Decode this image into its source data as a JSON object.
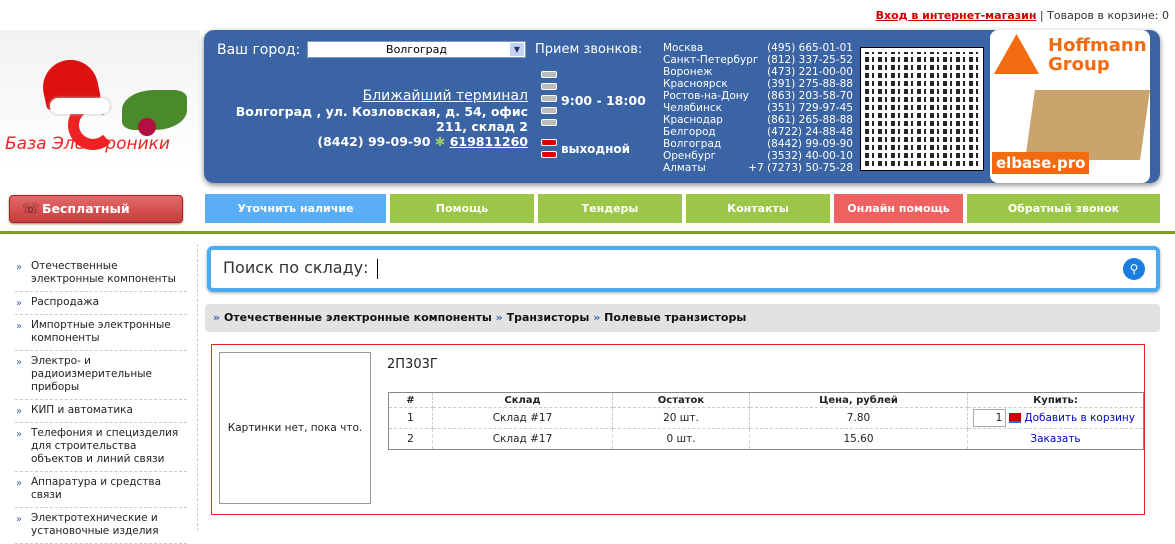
{
  "topbar": {
    "login": "Вход в интернет-магазин",
    "cart": "Товаров в корзине: 0"
  },
  "logo": {
    "text": "База Электроники"
  },
  "panel": {
    "city_label": "Ваш город:",
    "city_value": "Волгоград",
    "terminal_title": "Ближайший терминал",
    "address1": "Волгоград , ул. Козловская, д. 54, офис",
    "address2": "211, склад 2",
    "phone": "(8442) 99-09-90",
    "icq": "619811260",
    "calls_label": "Прием звонков:",
    "hours": "9:00 - 18:00",
    "dayoff": "выходной",
    "cities": [
      {
        "name": "Москва",
        "phone": "(495) 665-01-01"
      },
      {
        "name": "Санкт-Петербург",
        "phone": "(812) 337-25-52"
      },
      {
        "name": "Воронеж",
        "phone": "(473) 221-00-00"
      },
      {
        "name": "Красноярск",
        "phone": "(391) 275-88-88"
      },
      {
        "name": "Ростов-на-Дону",
        "phone": "(863) 203-58-70"
      },
      {
        "name": "Челябинск",
        "phone": "(351) 729-97-45"
      },
      {
        "name": "Краснодар",
        "phone": "(861) 265-88-88"
      },
      {
        "name": "Белгород",
        "phone": "(4722) 24-88-48"
      },
      {
        "name": "Волгоград",
        "phone": "(8442) 99-09-90"
      },
      {
        "name": "Оренбург",
        "phone": "(3532) 40-00-10"
      },
      {
        "name": "Алматы",
        "phone": "+7 (7273) 50-75-28"
      }
    ],
    "ad_brand": "Hoffmann Group",
    "ad_site": "elbase.pro"
  },
  "free_call": "Бесплатный звонок",
  "nav": [
    {
      "label": "Уточнить наличие",
      "color": "#5aaef5"
    },
    {
      "label": "Помощь",
      "color": "#9cc64a"
    },
    {
      "label": "Тендеры",
      "color": "#9cc64a"
    },
    {
      "label": "Контакты",
      "color": "#9cc64a"
    },
    {
      "label": "Онлайн помощь",
      "color": "#f06262"
    },
    {
      "label": "Обратный звонок",
      "color": "#9cc64a"
    }
  ],
  "sidebar": [
    "Отечественные электронные компоненты",
    "Распродажа",
    "Импортные электронные компоненты",
    "Электро- и радиоизмерительные приборы",
    "КИП и автоматика",
    "Телефония и специзделия для строительства объектов и линий связи",
    "Аппаратура и средства связи",
    "Электротехнические и установочные изделия"
  ],
  "search": {
    "label": "Поиск по складу:"
  },
  "breadcrumb": [
    "Отечественные электронные компоненты",
    "Транзисторы",
    "Полевые транзисторы"
  ],
  "product": {
    "no_image": "Картинки нет, пока что.",
    "title": "2П303Г",
    "headers": [
      "#",
      "Склад",
      "Остаток",
      "Цена, рублей",
      "Купить:"
    ],
    "rows": [
      {
        "n": "1",
        "store": "Склад #17",
        "stock": "20 шт.",
        "price": "7.80",
        "qty": "1",
        "action": "Добавить в корзину"
      },
      {
        "n": "2",
        "store": "Склад #17",
        "stock": "0 шт.",
        "price": "15.60",
        "action": "Заказать"
      }
    ]
  }
}
